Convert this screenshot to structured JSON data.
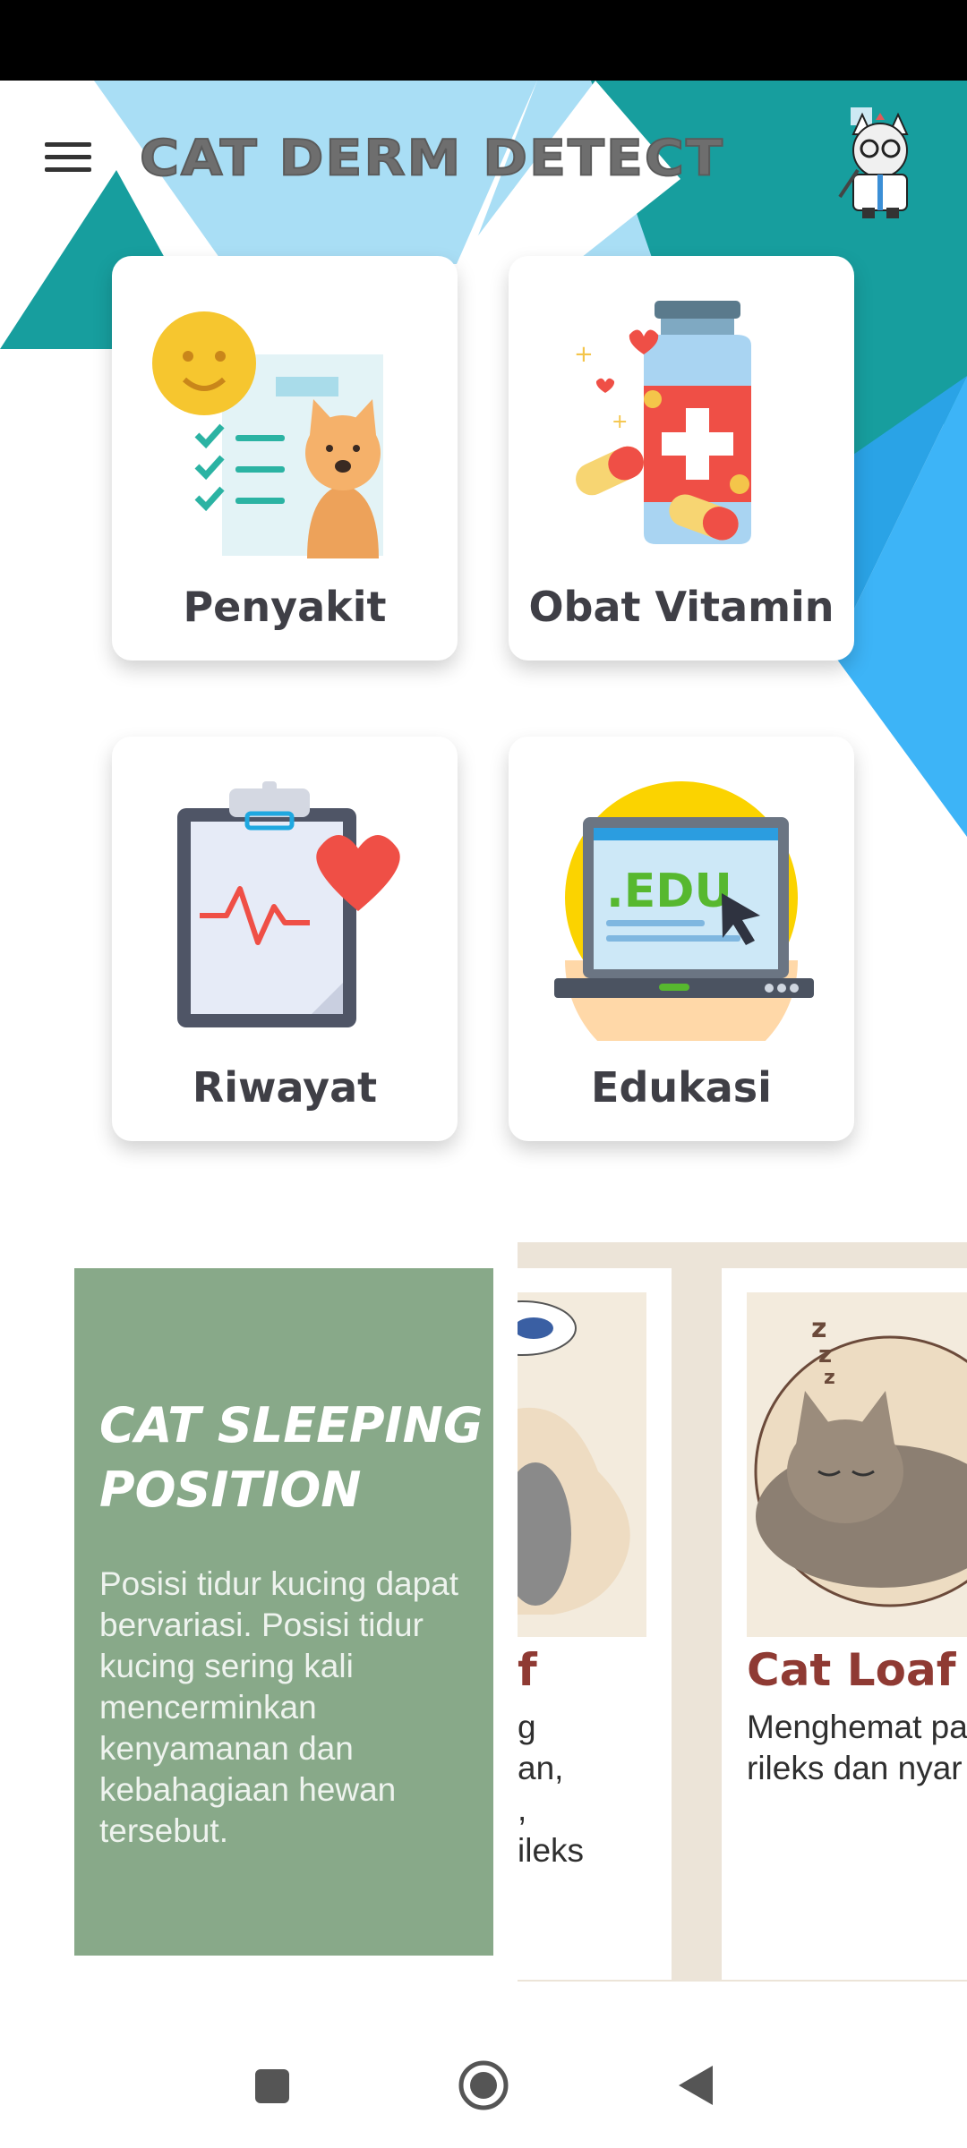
{
  "header": {
    "title": "CAT DERM DETECT",
    "menu_icon": "hamburger-menu-icon",
    "avatar_icon": "cat-doctor-avatar-icon"
  },
  "menu": {
    "items": [
      {
        "label": "Penyakit",
        "icon": "medical-checklist-cat-icon"
      },
      {
        "label": "Obat Vitamin",
        "icon": "medicine-bottle-icon"
      },
      {
        "label": "Riwayat",
        "icon": "clipboard-heart-icon"
      },
      {
        "label": "Edukasi",
        "icon": "edu-laptop-icon"
      }
    ]
  },
  "promo": {
    "title_line1": "CAT SLEEPING",
    "title_line2": "POSITION",
    "description": "Posisi tidur kucing dapat bervariasi. Posisi tidur kucing sering kali mencerminkan kenyamanan dan kebahagiaan hewan tersebut."
  },
  "slides": [
    {
      "title_fragment": "f",
      "text_lines": [
        "g",
        "an,",
        ",",
        "ileks"
      ]
    },
    {
      "title": "Cat Loaf",
      "text_lines": [
        "Menghemat pa",
        "rileks dan nyar"
      ]
    }
  ],
  "navigation": {
    "recents_icon": "square-recents-icon",
    "home_icon": "circle-home-icon",
    "back_icon": "triangle-back-icon"
  },
  "colors": {
    "teal": "#179e9e",
    "light_blue": "#a9def5",
    "bright_blue": "#3db4f7",
    "promo_green": "#88a989",
    "slide_title": "#8f3a33"
  }
}
